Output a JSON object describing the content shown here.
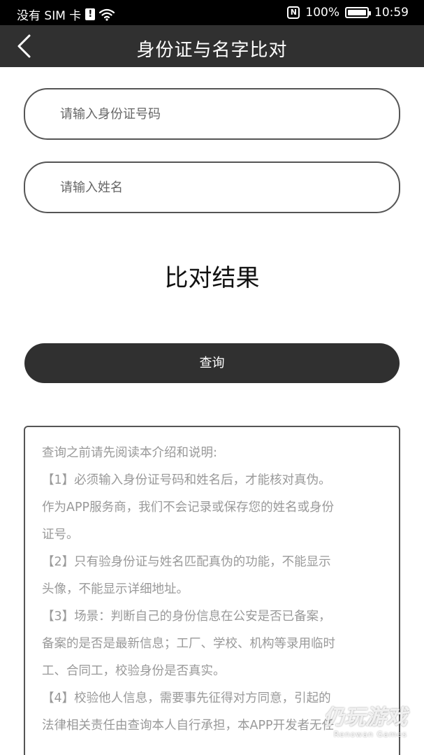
{
  "status_bar": {
    "carrier": "没有 SIM 卡",
    "sim_alert": "!",
    "nfc": "N",
    "battery_text": "100%",
    "battery_level": 1.0,
    "time": "10:59"
  },
  "header": {
    "title": "身份证与名字比对",
    "back_icon": "chevron-left-icon"
  },
  "form": {
    "id_placeholder": "请输入身份证号码",
    "name_placeholder": "请输入姓名",
    "result_title": "比对结果",
    "query_label": "查询"
  },
  "notice": {
    "lines": [
      "查询之前请先阅读本介绍和说明:",
      "【1】必须输入身份证号码和姓名后，才能核对真伪。",
      "作为APP服务商，我们不会记录或保存您的姓名或身份",
      "证号。",
      "【2】只有验身份证与姓名匹配真伪的功能，不能显示",
      "头像，不能显示详细地址。",
      "【3】场景：判断自己的身份信息在公安是否已备案，",
      "备案的是否是最新信息；工厂、学校、机构等录用临时",
      "工、合同工，校验身份是否真实。",
      "【4】校验他人信息，需要事先征得对方同意，引起的",
      "法律相关责任由查询本人自行承担，本APP开发者无任"
    ]
  },
  "watermark": {
    "cn": "仍玩游戏",
    "en": "Renowan Games"
  },
  "colors": {
    "nav_bg": "#303030",
    "status_bg": "#000000",
    "border": "#555555",
    "notice_text": "#999999"
  }
}
